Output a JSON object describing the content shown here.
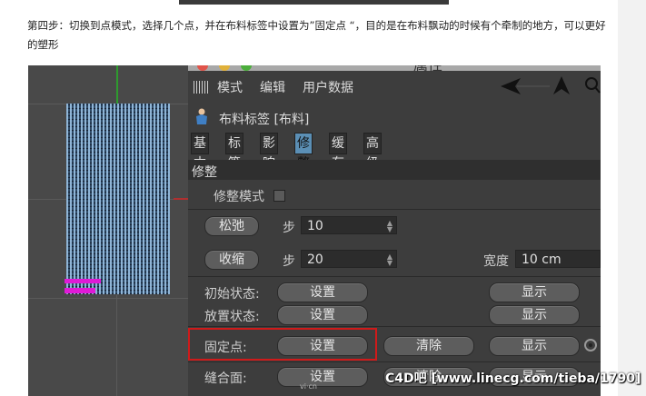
{
  "article": {
    "step_text": "第四步：切换到点模式，选择几个点，并在布料标签中设置为”固定点 “，目的是在布料飘动的时候有个牵制的地方，可以更好的塑形"
  },
  "panel": {
    "title": "属性",
    "menu": [
      "模式",
      "编辑",
      "用户数据"
    ],
    "tag_title": "布料标签 [布料]",
    "tabs": [
      {
        "label": "基本",
        "active": false
      },
      {
        "label": "标签",
        "active": false
      },
      {
        "label": "影响",
        "active": false
      },
      {
        "label": "修整",
        "active": true
      },
      {
        "label": "缓存",
        "active": false
      },
      {
        "label": "高级",
        "active": false
      }
    ],
    "section": "修整",
    "dress_mode_label": "修整模式",
    "relax": {
      "button": "松弛",
      "step_label": "步",
      "step_value": "10"
    },
    "shrink": {
      "button": "收缩",
      "step_label": "步",
      "step_value": "20",
      "width_label": "宽度",
      "width_value": "10 cm"
    },
    "init_state": {
      "label": "初始状态:",
      "set": "设置",
      "show": "显示"
    },
    "relax_state": {
      "label": "放置状态:",
      "set": "设置",
      "show": "显示"
    },
    "fix_points": {
      "label": "固定点:",
      "set": "设置",
      "clear": "清除",
      "show": "显示"
    },
    "seam": {
      "label": "缝合面:",
      "set": "设置",
      "clear": "清除",
      "show": "显示"
    }
  },
  "watermark": "C4D吧 [www.linecg.com/tieba/1790]",
  "small_mark": "vi·cn",
  "colors": {
    "accent_tab": "#5b8fb5",
    "fix_points": "#e01ad6",
    "highlight": "#d01a1a"
  }
}
